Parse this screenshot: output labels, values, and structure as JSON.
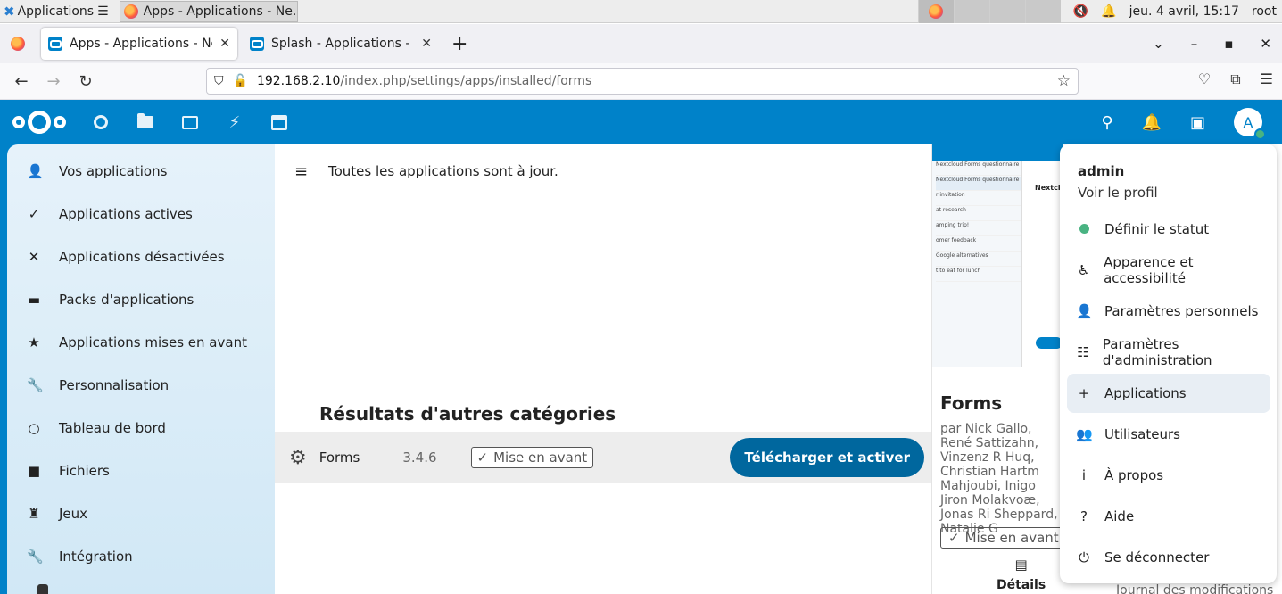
{
  "os_panel": {
    "app_menu_label": "Applications",
    "taskbar_item_title": "Apps - Applications - Ne...",
    "clock": "jeu.  4 avril, 15:17",
    "user": "root"
  },
  "browser": {
    "tabs": [
      {
        "title": "Apps - Applications - Nextcloud",
        "active": true
      },
      {
        "title": "Splash - Applications - Apps",
        "active": false
      }
    ],
    "url_host": "192.168.2.10",
    "url_path": "/index.php/settings/apps/installed/forms"
  },
  "header": {
    "avatar_letter": "A",
    "status_color": "#49b382",
    "brand_color": "#0082c9"
  },
  "sidebar": {
    "items": [
      {
        "label": "Vos applications",
        "icon": "user-icon"
      },
      {
        "label": "Applications actives",
        "icon": "check-icon"
      },
      {
        "label": "Applications désactivées",
        "icon": "close-icon"
      },
      {
        "label": "Packs d'applications",
        "icon": "archive-icon"
      },
      {
        "label": "Applications mises en avant",
        "icon": "star-icon"
      },
      {
        "label": "Personnalisation",
        "icon": "wrench-icon"
      },
      {
        "label": "Tableau de bord",
        "icon": "circle-icon"
      },
      {
        "label": "Fichiers",
        "icon": "folder-icon"
      },
      {
        "label": "Jeux",
        "icon": "chess-icon"
      },
      {
        "label": "Intégration",
        "icon": "wrench-icon"
      }
    ]
  },
  "main": {
    "status_message": "Toutes les applications sont à jour.",
    "other_categories_heading": "Résultats d'autres catégories",
    "app_row": {
      "name": "Forms",
      "version": "3.4.6",
      "featured_label": "Mise en avant",
      "install_label": "Télécharger et activer"
    }
  },
  "details": {
    "title": "Forms",
    "authors": "par Nick Gallo, René Sattizahn, Vinzenz R Huq, Christian Hartm Mahjoubi, Inigo Jiron Molakvoæ, Jonas Ri Sheppard, Natalie G",
    "featured_label": "Mise en avant",
    "tab_details": "Détails",
    "tab_changelog": "Journal des modifications",
    "preview_heading": "Nextcl",
    "preview_rows": [
      "Nextcloud Forms questionnaire",
      "r invitation",
      "at research",
      "amping trip!",
      "omer feedback",
      "Google alternatives",
      "t to eat for lunch"
    ]
  },
  "user_menu": {
    "username": "admin",
    "view_profile": "Voir le profil",
    "items": [
      {
        "label": "Définir le statut",
        "icon": "status-icon"
      },
      {
        "label": "Apparence et accessibilité",
        "icon": "accessibility-icon"
      },
      {
        "label": "Paramètres personnels",
        "icon": "user-icon"
      },
      {
        "label": "Paramètres d'administration",
        "icon": "admin-list-icon"
      },
      {
        "label": "Applications",
        "icon": "plus-icon"
      },
      {
        "label": "Utilisateurs",
        "icon": "users-icon"
      },
      {
        "label": "À propos",
        "icon": "info-icon"
      },
      {
        "label": "Aide",
        "icon": "help-icon"
      },
      {
        "label": "Se déconnecter",
        "icon": "power-icon"
      }
    ]
  }
}
